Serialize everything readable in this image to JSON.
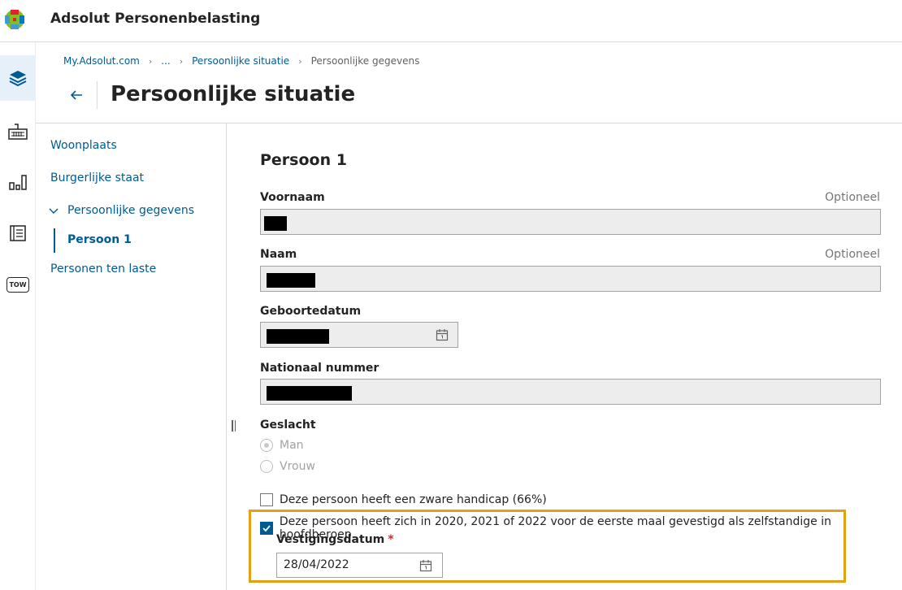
{
  "app": {
    "title": "Adsolut Personenbelasting"
  },
  "rail": {
    "items": [
      {
        "icon": "layers-icon",
        "active": true
      },
      {
        "icon": "keyboard-icon",
        "active": false
      },
      {
        "icon": "bar-chart-icon",
        "active": false
      },
      {
        "icon": "document-icon",
        "active": false
      },
      {
        "icon": "tow-icon",
        "label": "TOW",
        "active": false
      }
    ]
  },
  "breadcrumb": {
    "items": [
      "My.Adsolut.com",
      "...",
      "Persoonlijke situatie"
    ],
    "current": "Persoonlijke gegevens"
  },
  "page": {
    "title": "Persoonlijke situatie"
  },
  "leftnav": {
    "items": [
      "Woonplaats",
      "Burgerlijke staat",
      "Persoonlijke gegevens",
      "Personen ten laste"
    ],
    "sub_item": "Persoon 1"
  },
  "form": {
    "section_title": "Persoon 1",
    "optional_label": "Optioneel",
    "fields": {
      "first_name": {
        "label": "Voornaam"
      },
      "last_name": {
        "label": "Naam"
      },
      "birth_date": {
        "label": "Geboortedatum"
      },
      "national_number": {
        "label": "Nationaal nummer"
      }
    },
    "gender": {
      "label": "Geslacht",
      "options": [
        "Man",
        "Vrouw"
      ],
      "selected": "Man"
    },
    "handicap_checkbox": {
      "label": "Deze persoon heeft een zware handicap (66%)",
      "checked": false
    },
    "self_employed_checkbox": {
      "label": "Deze persoon heeft zich in 2020, 2021 of 2022 voor de eerste maal gevestigd als zelfstandige in hoofdberoep.",
      "checked": true
    },
    "establishment_date": {
      "label": "Vestigingsdatum",
      "required_mark": "*",
      "value": "28/04/2022"
    }
  },
  "colors": {
    "accent": "#005b92",
    "highlight": "#e5a114",
    "required": "#e5202e"
  }
}
